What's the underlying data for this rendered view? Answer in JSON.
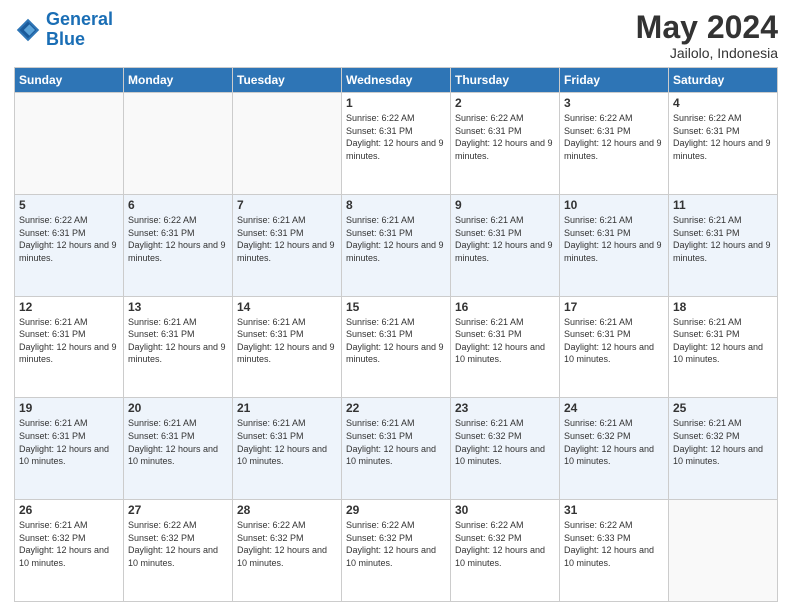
{
  "logo": {
    "line1": "General",
    "line2": "Blue"
  },
  "title": "May 2024",
  "location": "Jailolo, Indonesia",
  "weekdays": [
    "Sunday",
    "Monday",
    "Tuesday",
    "Wednesday",
    "Thursday",
    "Friday",
    "Saturday"
  ],
  "weeks": [
    [
      {
        "day": "",
        "info": ""
      },
      {
        "day": "",
        "info": ""
      },
      {
        "day": "",
        "info": ""
      },
      {
        "day": "1",
        "info": "Sunrise: 6:22 AM\nSunset: 6:31 PM\nDaylight: 12 hours and 9 minutes."
      },
      {
        "day": "2",
        "info": "Sunrise: 6:22 AM\nSunset: 6:31 PM\nDaylight: 12 hours and 9 minutes."
      },
      {
        "day": "3",
        "info": "Sunrise: 6:22 AM\nSunset: 6:31 PM\nDaylight: 12 hours and 9 minutes."
      },
      {
        "day": "4",
        "info": "Sunrise: 6:22 AM\nSunset: 6:31 PM\nDaylight: 12 hours and 9 minutes."
      }
    ],
    [
      {
        "day": "5",
        "info": "Sunrise: 6:22 AM\nSunset: 6:31 PM\nDaylight: 12 hours and 9 minutes."
      },
      {
        "day": "6",
        "info": "Sunrise: 6:22 AM\nSunset: 6:31 PM\nDaylight: 12 hours and 9 minutes."
      },
      {
        "day": "7",
        "info": "Sunrise: 6:21 AM\nSunset: 6:31 PM\nDaylight: 12 hours and 9 minutes."
      },
      {
        "day": "8",
        "info": "Sunrise: 6:21 AM\nSunset: 6:31 PM\nDaylight: 12 hours and 9 minutes."
      },
      {
        "day": "9",
        "info": "Sunrise: 6:21 AM\nSunset: 6:31 PM\nDaylight: 12 hours and 9 minutes."
      },
      {
        "day": "10",
        "info": "Sunrise: 6:21 AM\nSunset: 6:31 PM\nDaylight: 12 hours and 9 minutes."
      },
      {
        "day": "11",
        "info": "Sunrise: 6:21 AM\nSunset: 6:31 PM\nDaylight: 12 hours and 9 minutes."
      }
    ],
    [
      {
        "day": "12",
        "info": "Sunrise: 6:21 AM\nSunset: 6:31 PM\nDaylight: 12 hours and 9 minutes."
      },
      {
        "day": "13",
        "info": "Sunrise: 6:21 AM\nSunset: 6:31 PM\nDaylight: 12 hours and 9 minutes."
      },
      {
        "day": "14",
        "info": "Sunrise: 6:21 AM\nSunset: 6:31 PM\nDaylight: 12 hours and 9 minutes."
      },
      {
        "day": "15",
        "info": "Sunrise: 6:21 AM\nSunset: 6:31 PM\nDaylight: 12 hours and 9 minutes."
      },
      {
        "day": "16",
        "info": "Sunrise: 6:21 AM\nSunset: 6:31 PM\nDaylight: 12 hours and 10 minutes."
      },
      {
        "day": "17",
        "info": "Sunrise: 6:21 AM\nSunset: 6:31 PM\nDaylight: 12 hours and 10 minutes."
      },
      {
        "day": "18",
        "info": "Sunrise: 6:21 AM\nSunset: 6:31 PM\nDaylight: 12 hours and 10 minutes."
      }
    ],
    [
      {
        "day": "19",
        "info": "Sunrise: 6:21 AM\nSunset: 6:31 PM\nDaylight: 12 hours and 10 minutes."
      },
      {
        "day": "20",
        "info": "Sunrise: 6:21 AM\nSunset: 6:31 PM\nDaylight: 12 hours and 10 minutes."
      },
      {
        "day": "21",
        "info": "Sunrise: 6:21 AM\nSunset: 6:31 PM\nDaylight: 12 hours and 10 minutes."
      },
      {
        "day": "22",
        "info": "Sunrise: 6:21 AM\nSunset: 6:31 PM\nDaylight: 12 hours and 10 minutes."
      },
      {
        "day": "23",
        "info": "Sunrise: 6:21 AM\nSunset: 6:32 PM\nDaylight: 12 hours and 10 minutes."
      },
      {
        "day": "24",
        "info": "Sunrise: 6:21 AM\nSunset: 6:32 PM\nDaylight: 12 hours and 10 minutes."
      },
      {
        "day": "25",
        "info": "Sunrise: 6:21 AM\nSunset: 6:32 PM\nDaylight: 12 hours and 10 minutes."
      }
    ],
    [
      {
        "day": "26",
        "info": "Sunrise: 6:21 AM\nSunset: 6:32 PM\nDaylight: 12 hours and 10 minutes."
      },
      {
        "day": "27",
        "info": "Sunrise: 6:22 AM\nSunset: 6:32 PM\nDaylight: 12 hours and 10 minutes."
      },
      {
        "day": "28",
        "info": "Sunrise: 6:22 AM\nSunset: 6:32 PM\nDaylight: 12 hours and 10 minutes."
      },
      {
        "day": "29",
        "info": "Sunrise: 6:22 AM\nSunset: 6:32 PM\nDaylight: 12 hours and 10 minutes."
      },
      {
        "day": "30",
        "info": "Sunrise: 6:22 AM\nSunset: 6:32 PM\nDaylight: 12 hours and 10 minutes."
      },
      {
        "day": "31",
        "info": "Sunrise: 6:22 AM\nSunset: 6:33 PM\nDaylight: 12 hours and 10 minutes."
      },
      {
        "day": "",
        "info": ""
      }
    ]
  ]
}
